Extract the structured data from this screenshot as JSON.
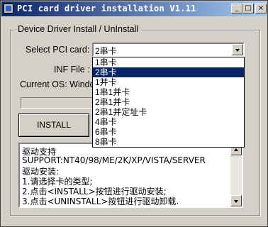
{
  "window": {
    "title": "PCI card driver installation V1.11",
    "minimize": "_",
    "maximize": "□",
    "close": "×"
  },
  "group": {
    "title": "Device Driver Install / UnInstall"
  },
  "select": {
    "label": "Select PCI card:",
    "value": "2串卡",
    "options": [
      "1串卡",
      "2串卡",
      "1并卡",
      "1串1并卡",
      "2串1并卡",
      "2串1并定址卡",
      "4串卡",
      "6串卡",
      "8串卡"
    ]
  },
  "inf": {
    "label": "INF File :"
  },
  "os": {
    "label": "Current OS: Windo"
  },
  "install_button": "INSTALL",
  "info": {
    "lines": [
      "驱动支持",
      "SUPPORT:NT40/98/ME/2K/XP/VISTA/SERVER",
      "驱动安装:",
      "1.请选择卡的类型;",
      "2.点击<INSTALL>按钮进行驱动安装;",
      "3.点击<UNINSTALL>按钮进行驱动卸载."
    ]
  }
}
